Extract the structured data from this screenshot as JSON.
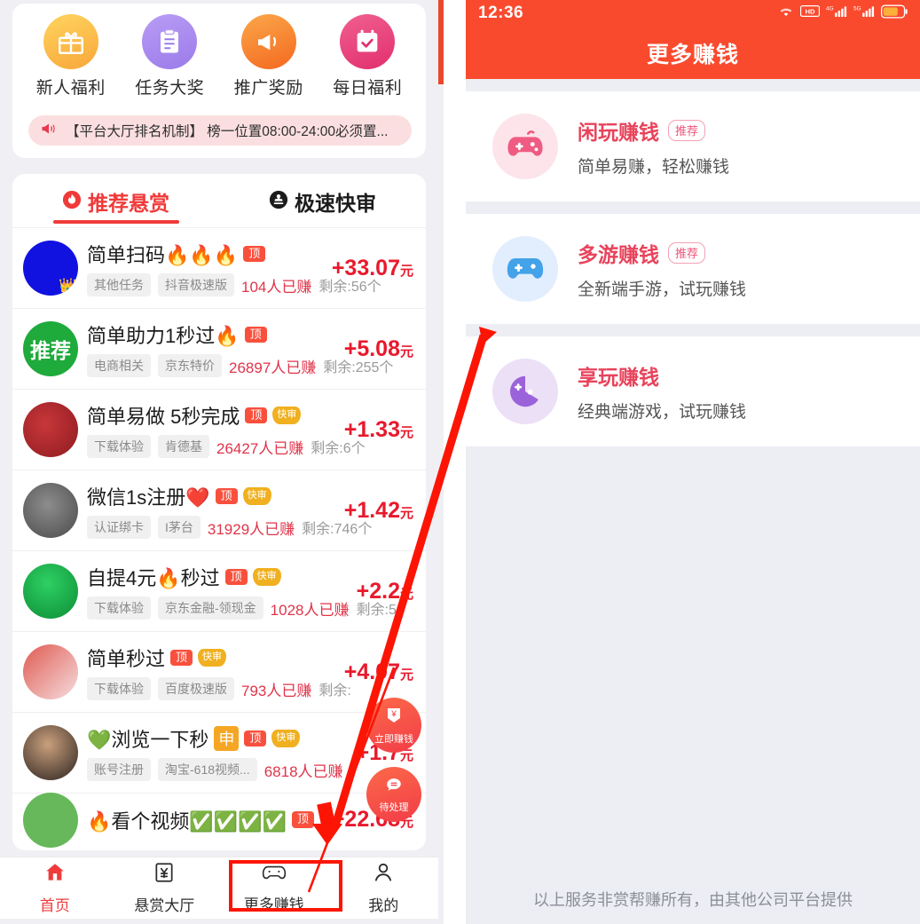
{
  "left": {
    "quick_entries": [
      {
        "label": "新人福利",
        "icon": "gift-icon"
      },
      {
        "label": "任务大奖",
        "icon": "clipboard-icon"
      },
      {
        "label": "推广奖励",
        "icon": "megaphone-icon"
      },
      {
        "label": "每日福利",
        "icon": "calendar-check-icon"
      }
    ],
    "notice": {
      "icon": "speaker-icon",
      "text": "【平台大厅排名机制】 榜一位置08:00-24:00必须置..."
    },
    "tabs": [
      {
        "label": "推荐悬赏",
        "icon": "fire-icon",
        "active": true
      },
      {
        "label": "极速快审",
        "icon": "stamp-icon",
        "active": false
      }
    ],
    "tasks": [
      {
        "title": "简单扫码🔥🔥🔥",
        "badges": [
          "顶"
        ],
        "chips": [
          "其他任务",
          "抖音极速版"
        ],
        "earned": "104人已赚",
        "remain": "剩余:56个",
        "price": "+33.07",
        "unit": "元",
        "avatar_color": "#1112e0"
      },
      {
        "title": "简单助力1秒过🔥",
        "badges": [
          "顶"
        ],
        "chips": [
          "电商相关",
          "京东特价"
        ],
        "earned": "26897人已赚",
        "remain": "剩余:255个",
        "price": "+5.08",
        "unit": "元",
        "avatar_color": "#1faa3c",
        "avatar_text": "推荐"
      },
      {
        "title": "简单易做 5秒完成",
        "badges": [
          "顶",
          "快审"
        ],
        "chips": [
          "下载体验",
          "肯德基"
        ],
        "earned": "26427人已赚",
        "remain": "剩余:6个",
        "price": "+1.33",
        "unit": "元",
        "avatar_color": "#a8242a"
      },
      {
        "title": "微信1s注册❤️",
        "badges": [
          "顶",
          "快审"
        ],
        "chips": [
          "认证绑卡",
          "I茅台"
        ],
        "earned": "31929人已赚",
        "remain": "剩余:746个",
        "price": "+1.42",
        "unit": "元",
        "avatar_color": "#6b6b6b"
      },
      {
        "title": "自提4元🔥秒过",
        "badges": [
          "顶",
          "快审"
        ],
        "chips": [
          "下载体验",
          "京东金融-领现金"
        ],
        "earned": "1028人已赚",
        "remain": "剩余:59",
        "price": "+2.2",
        "unit": "元",
        "avatar_color": "#17b24a"
      },
      {
        "title": "简单秒过",
        "badges": [
          "顶",
          "快审"
        ],
        "chips": [
          "下载体验",
          "百度极速版"
        ],
        "earned": "793人已赚",
        "remain": "剩余:",
        "price": "+4.07",
        "unit": "元",
        "avatar_color": "#d8605c"
      },
      {
        "title": "💚浏览一下秒",
        "badges": [
          "申",
          "顶",
          "快审"
        ],
        "chips": [
          "账号注册",
          "淘宝-618视频..."
        ],
        "earned": "6818人已赚",
        "remain": "",
        "price": "+1.7",
        "unit": "元",
        "avatar_color": "#3b2d2a"
      },
      {
        "title": "🔥看个视频✅✅✅✅",
        "badges": [
          "顶"
        ],
        "chips": [],
        "earned": "",
        "remain": "",
        "price": "+22.68",
        "unit": "元",
        "avatar_color": "#66b85a"
      }
    ],
    "fabs": [
      {
        "label": "立即赚钱",
        "icon": "yuan-download-icon"
      },
      {
        "label": "待处理",
        "icon": "message-icon"
      }
    ],
    "bottom_nav": [
      {
        "label": "首页",
        "icon": "home-icon",
        "active": true
      },
      {
        "label": "悬赏大厅",
        "icon": "yuan-box-icon",
        "active": false
      },
      {
        "label": "更多赚钱",
        "icon": "gamepad-icon",
        "active": false
      },
      {
        "label": "我的",
        "icon": "person-icon",
        "active": false
      }
    ]
  },
  "right": {
    "status_bar": {
      "time": "12:36",
      "icons": [
        "wifi-icon",
        "hd-icon",
        "signal-4g-icon",
        "signal-5g-icon",
        "battery-icon"
      ],
      "signal_4g_label": "4G",
      "signal_5g_label": "5G",
      "hd_label": "HD"
    },
    "app_bar": {
      "title": "更多赚钱"
    },
    "services": [
      {
        "title": "闲玩赚钱",
        "tag": "推荐",
        "desc": "简单易赚，轻松赚钱",
        "icon": "gamepad-pink-icon",
        "icon_bg": "#fce4ea",
        "icon_fg": "#ef5b82"
      },
      {
        "title": "多游赚钱",
        "tag": "推荐",
        "desc": "全新端手游，试玩赚钱",
        "icon": "gamepad-blue-icon",
        "icon_bg": "#e2edfd",
        "icon_fg": "#44a2e8"
      },
      {
        "title": "享玩赚钱",
        "tag": "",
        "desc": "经典端游戏，试玩赚钱",
        "icon": "pacman-purple-icon",
        "icon_bg": "#ece0f7",
        "icon_fg": "#9b63da"
      }
    ],
    "footer": {
      "text": "以上服务非赏帮赚所有，由其他公司平台提供"
    }
  },
  "colors": {
    "brand_red": "#fa4a2e",
    "price_red": "#e8192c",
    "annotation_red": "#fc1505"
  }
}
